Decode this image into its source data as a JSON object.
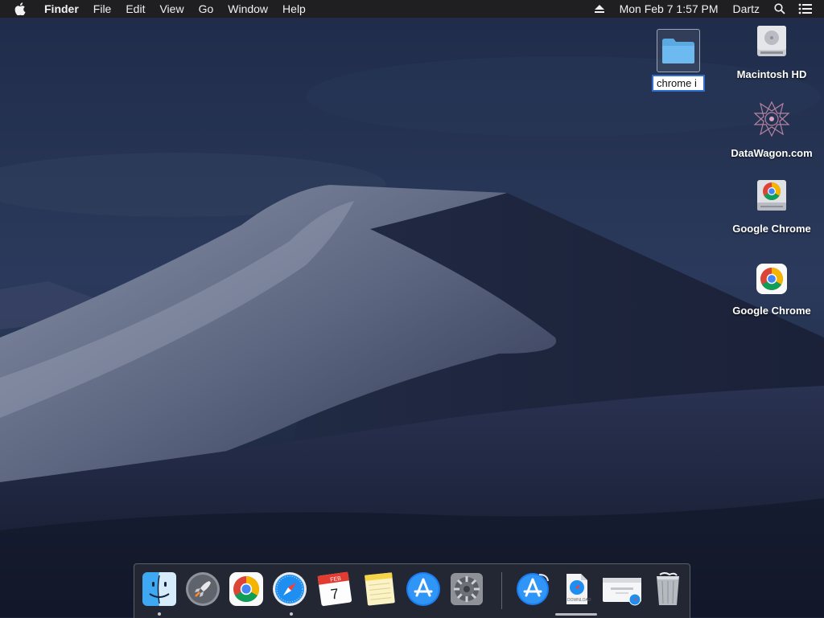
{
  "menubar": {
    "app_name": "Finder",
    "menus": [
      "File",
      "Edit",
      "View",
      "Go",
      "Window",
      "Help"
    ],
    "datetime": "Mon Feb 7  1:57 PM",
    "user": "Dartz",
    "icons": [
      "apple-logo-icon",
      "eject-icon",
      "spotlight-search-icon",
      "notification-center-icon"
    ]
  },
  "desktop": {
    "renaming_folder": {
      "value": "chrome i",
      "icon": "folder-icon"
    },
    "items": [
      {
        "label": "Macintosh HD",
        "icon": "hard-drive-icon"
      },
      {
        "label": "DataWagon.com",
        "icon": "network-volume-icon"
      },
      {
        "label": "Google Chrome",
        "icon": "chrome-disk-image-icon"
      },
      {
        "label": "Google Chrome",
        "icon": "chrome-app-icon"
      }
    ]
  },
  "dock": {
    "apps": [
      {
        "name": "Finder",
        "icon": "finder-icon",
        "running": true
      },
      {
        "name": "Launchpad",
        "icon": "launchpad-icon",
        "running": false
      },
      {
        "name": "Google Chrome",
        "icon": "chrome-icon",
        "running": false
      },
      {
        "name": "Safari",
        "icon": "safari-icon",
        "running": true
      },
      {
        "name": "Calendar",
        "icon": "calendar-icon",
        "running": false,
        "month": "FEB",
        "day": "7"
      },
      {
        "name": "Notes",
        "icon": "notes-icon",
        "running": false
      },
      {
        "name": "App Store",
        "icon": "app-store-icon",
        "running": false
      },
      {
        "name": "System Preferences",
        "icon": "system-preferences-icon",
        "running": false
      }
    ],
    "stacks": [
      {
        "name": "Applications",
        "icon": "applications-stack-icon"
      },
      {
        "name": "Downloads",
        "icon": "downloads-stack-icon",
        "label": "DOWNLOAD"
      },
      {
        "name": "Safari window",
        "icon": "minimized-window-icon"
      },
      {
        "name": "Trash",
        "icon": "trash-icon"
      }
    ]
  },
  "colors": {
    "menubar_bg": "#1f1f22",
    "selection_blue": "#2f6fcd",
    "sky_top": "#1d2a48",
    "sky_bottom": "#141b2c"
  }
}
